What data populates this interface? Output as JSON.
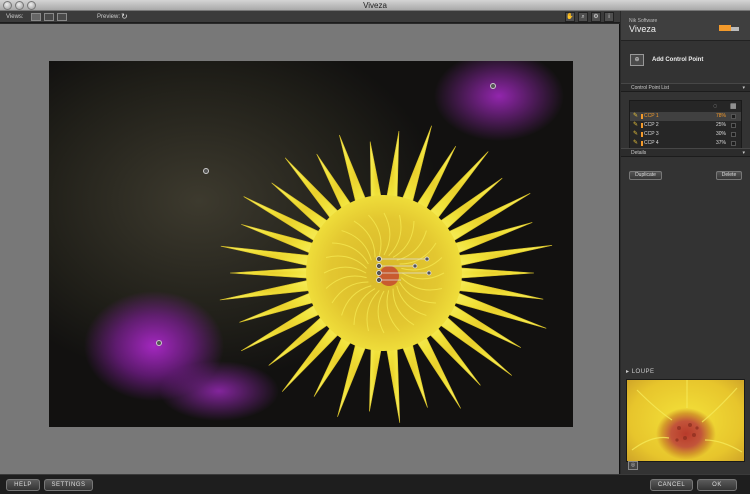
{
  "window": {
    "title": "Viveza"
  },
  "toolbar": {
    "views_label": "Views:",
    "preview_label": "Preview:"
  },
  "panel": {
    "company": "Nik Software",
    "product": "Viveza",
    "add_control_point_label": "Add Control Point",
    "control_point_list_label": "Control Point List",
    "details_label": "Details",
    "duplicate_label": "Duplicate",
    "delete_label": "Delete",
    "loupe_label": "LOUPE",
    "control_points": [
      {
        "name": "CCP 1",
        "percent": "78%",
        "selected": true
      },
      {
        "name": "CCP 2",
        "percent": "25%",
        "selected": false
      },
      {
        "name": "CCP 3",
        "percent": "30%",
        "selected": false
      },
      {
        "name": "CCP 4",
        "percent": "37%",
        "selected": false
      }
    ]
  },
  "bottom": {
    "help_label": "HELP",
    "settings_label": "SETTINGS",
    "cancel_label": "CANCEL",
    "ok_label": "OK"
  },
  "icons": {
    "window_buttons": [
      "close-icon",
      "minimize-icon",
      "zoom-icon"
    ],
    "view_buttons": [
      "single-view-icon",
      "split-view-icon",
      "side-by-side-view-icon"
    ],
    "preview_toggle": "refresh-icon",
    "tools": [
      "hand-icon",
      "zoom-tool-icon",
      "gear-icon",
      "info-icon"
    ]
  },
  "colors": {
    "accent_orange": "#f39a2b",
    "flower_yellow": "#f1e23a",
    "background_purple": "#a82fc4"
  }
}
